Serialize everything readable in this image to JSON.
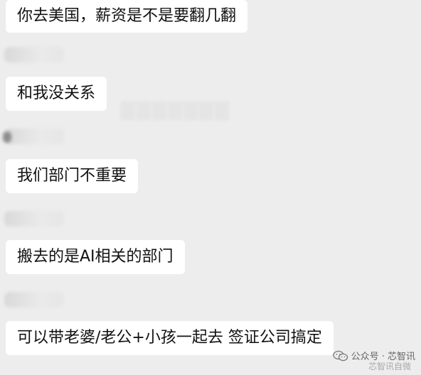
{
  "messages": [
    {
      "text": "你去美国，薪资是不是要翻几翻"
    },
    {
      "text": "和我没关系"
    },
    {
      "text": "我们部门不重要"
    },
    {
      "text": "搬去的是AI相关的部门"
    },
    {
      "text": "可以带老婆/老公+小孩一起去 签证公司搞定"
    }
  ],
  "watermark": {
    "label": "公众号 · 芯智讯",
    "secondary": "芯智讯自微",
    "icon": "wechat-icon"
  },
  "colors": {
    "background": "#ededed",
    "bubble": "#ffffff",
    "text": "#111111"
  }
}
